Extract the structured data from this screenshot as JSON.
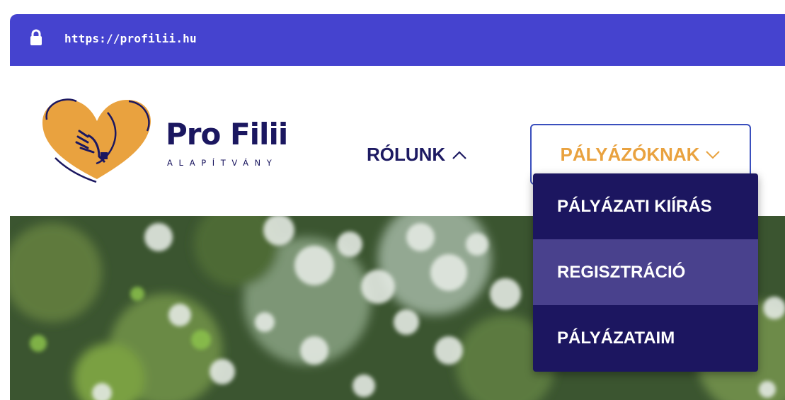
{
  "browser": {
    "url": "https://profilii.hu",
    "lock_icon": "lock-icon",
    "bar_color": "#4543cf"
  },
  "logo": {
    "name": "Pro Filii",
    "subtitle": "ALAPÍTVÁNY",
    "heart_color": "#e9a23f",
    "text_color": "#1b1760"
  },
  "nav": {
    "rolunk": {
      "label": "RÓLUNK",
      "icon": "chevron-up-icon"
    },
    "palyazoknak": {
      "label": "PÁLYÁZÓKNAK",
      "icon": "chevron-down-icon",
      "color": "#e9a23f"
    }
  },
  "dropdown": {
    "items": [
      {
        "label": "PÁLYÁZATI KIÍRÁS"
      },
      {
        "label": "REGISZTRÁCIÓ",
        "highlighted": true
      },
      {
        "label": "PÁLYÁZATAIM"
      }
    ],
    "bg_color": "#1c1660",
    "highlight_color": "#49418d"
  }
}
